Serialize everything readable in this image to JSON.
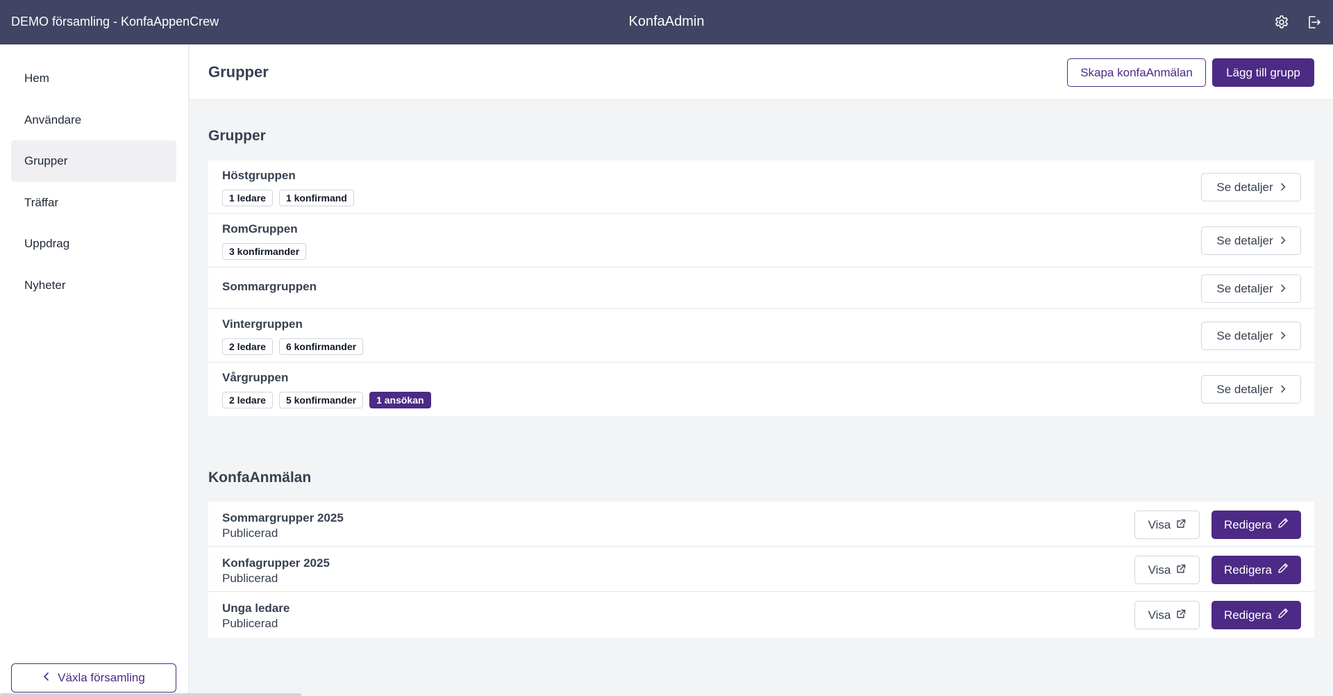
{
  "topbar": {
    "org_title": "DEMO församling - KonfaAppenCrew",
    "app_title": "KonfaAdmin",
    "icons": [
      "gear-icon",
      "logout-icon"
    ]
  },
  "sidebar": {
    "items": [
      {
        "label": "Hem",
        "active": false
      },
      {
        "label": "Användare",
        "active": false
      },
      {
        "label": "Grupper",
        "active": true
      },
      {
        "label": "Träffar",
        "active": false
      },
      {
        "label": "Uppdrag",
        "active": false
      },
      {
        "label": "Nyheter",
        "active": false
      }
    ],
    "switch_label": "Växla församling"
  },
  "header": {
    "title": "Grupper",
    "create_label": "Skapa konfaAnmälan",
    "add_label": "Lägg till grupp"
  },
  "groups_section": {
    "title": "Grupper",
    "detail_label": "Se detaljer",
    "groups": [
      {
        "name": "Höstgruppen",
        "badges": [
          "1 ledare",
          "1 konfirmand"
        ]
      },
      {
        "name": "RomGruppen",
        "badges": [
          "3 konfirmander"
        ]
      },
      {
        "name": "Sommargruppen",
        "badges": []
      },
      {
        "name": "Vintergruppen",
        "badges": [
          "2 ledare",
          "6 konfirmander"
        ]
      },
      {
        "name": "Vårgruppen",
        "badges": [
          "2 ledare",
          "5 konfirmander"
        ],
        "highlight": "1 ansökan"
      }
    ]
  },
  "anmalan_section": {
    "title": "KonfaAnmälan",
    "view_label": "Visa",
    "edit_label": "Redigera",
    "items": [
      {
        "name": "Sommargrupper 2025",
        "status": "Publicerad"
      },
      {
        "name": "Konfagrupper 2025",
        "status": "Publicerad"
      },
      {
        "name": "Unga ledare",
        "status": "Publicerad"
      }
    ]
  },
  "colors": {
    "topbar": "#424463",
    "accent": "#4c2a85"
  }
}
